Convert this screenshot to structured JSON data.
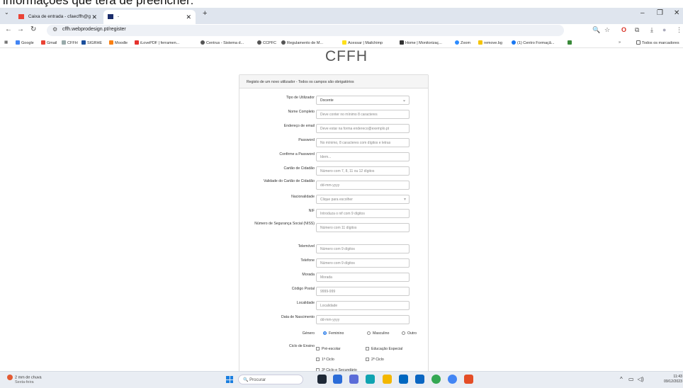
{
  "caption": "informações que terá de preencher:",
  "browser": {
    "tabs": [
      {
        "title": "Caixa de entrada - cfaecffh@g",
        "icon": "gmail-icon"
      },
      {
        "title": "-",
        "icon": "site-icon"
      }
    ],
    "new_tab": "+",
    "url": "cffh.webprodesign.pt/register",
    "bookmarks": [
      "Google",
      "Gmail",
      "CFFH",
      "SIGRHE",
      "Moodle",
      "iLovePDF | ferramen...",
      "Centrus - Sistema d...",
      "CCPFC",
      "Regulamento de M...",
      "Acessar | Mailchimp",
      "Home | Monitorizaç...",
      "Zoom",
      "remove.bg",
      "(1) Centro Formaçã...",
      "Todos os marcadores"
    ]
  },
  "page": {
    "logo": "CFFH",
    "panel_heading": "Registo de um novo utilizador - Todos os campos são obrigatórios",
    "fields": [
      {
        "label": "Tipo de Utilizador",
        "value": "Docente",
        "kind": "select"
      },
      {
        "label": "Nome Completo",
        "placeholder": "Deve conter no mínimo 8 caracteres"
      },
      {
        "label": "Endereço de email",
        "placeholder": "Deve estar na forma endereco@exemplo.pt"
      },
      {
        "label": "Password",
        "placeholder": "No mínimo, 8 caracteres com dígitos e letras"
      },
      {
        "label": "Confirme a Password",
        "placeholder": "Idem..."
      },
      {
        "label": "Cartão de Cidadão",
        "placeholder": "Número com 7, 8, 11 ou 12 dígitos"
      },
      {
        "label": "Validade do Cartão de Cidadão",
        "placeholder": "dd-mm-yyyy"
      },
      {
        "label": "Nacionalidade",
        "placeholder": "Clique para escolher",
        "kind": "select2"
      },
      {
        "label": "NIF",
        "placeholder": "Introduza o nif com 9 dígitos"
      },
      {
        "label": "Número de Segurança Social (NISS)",
        "placeholder": "Número com 11 dígitos"
      },
      {
        "label": "Telemóvel",
        "placeholder": "Número com 9 dígitos"
      },
      {
        "label": "Telefone",
        "placeholder": "Número com 9 dígitos"
      },
      {
        "label": "Morada",
        "placeholder": "Morada"
      },
      {
        "label": "Código Postal",
        "placeholder": "9999-999"
      },
      {
        "label": "Localidade",
        "placeholder": "Localidade"
      },
      {
        "label": "Data de Nascimento",
        "placeholder": "dd-mm-yyyy"
      }
    ],
    "gender": {
      "label": "Género",
      "options": [
        "Feminino",
        "Masculino",
        "Outro"
      ],
      "selected": "Feminino"
    },
    "cycle": {
      "label": "Ciclo de Ensino",
      "options": [
        "Pré-escolar",
        "Educação Especial",
        "1º Ciclo",
        "2º Ciclo",
        "3º Ciclo e Secundário"
      ]
    }
  },
  "taskbar": {
    "weather_line1": "2 mm de chuva",
    "weather_line2": "Sexta-feira",
    "weather_badge": "2",
    "search_placeholder": "Procurar",
    "time": "11:43",
    "date": "09/12/2023"
  }
}
